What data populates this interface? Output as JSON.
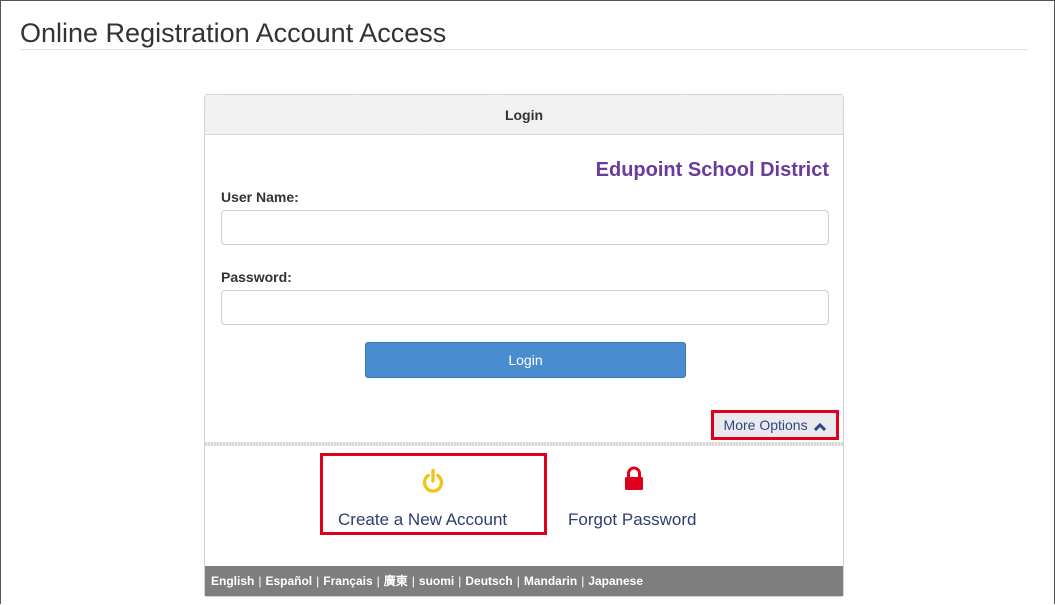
{
  "page": {
    "title": "Online Registration Account Access"
  },
  "panel": {
    "header": "Login",
    "district": "Edupoint School District",
    "username_label": "User Name:",
    "username_value": "",
    "password_label": "Password:",
    "password_value": "",
    "login_button": "Login",
    "more_options": "More Options",
    "create_account": "Create a New Account",
    "forgot_password": "Forgot Password"
  },
  "colors": {
    "district": "#6b3b9a",
    "login_button": "#4a8cd0",
    "create_icon": "#f0c419",
    "lock_icon": "#e0001b",
    "highlight_border": "#e0001b",
    "footer": "#7e7e7e"
  },
  "icons": {
    "create_account": "power-icon",
    "forgot_password": "lock-icon",
    "more_options": "chevron-up-icon"
  },
  "languages": [
    "English",
    "Español",
    "Français",
    "廣東",
    "suomi",
    "Deutsch",
    "Mandarin",
    "Japanese"
  ]
}
